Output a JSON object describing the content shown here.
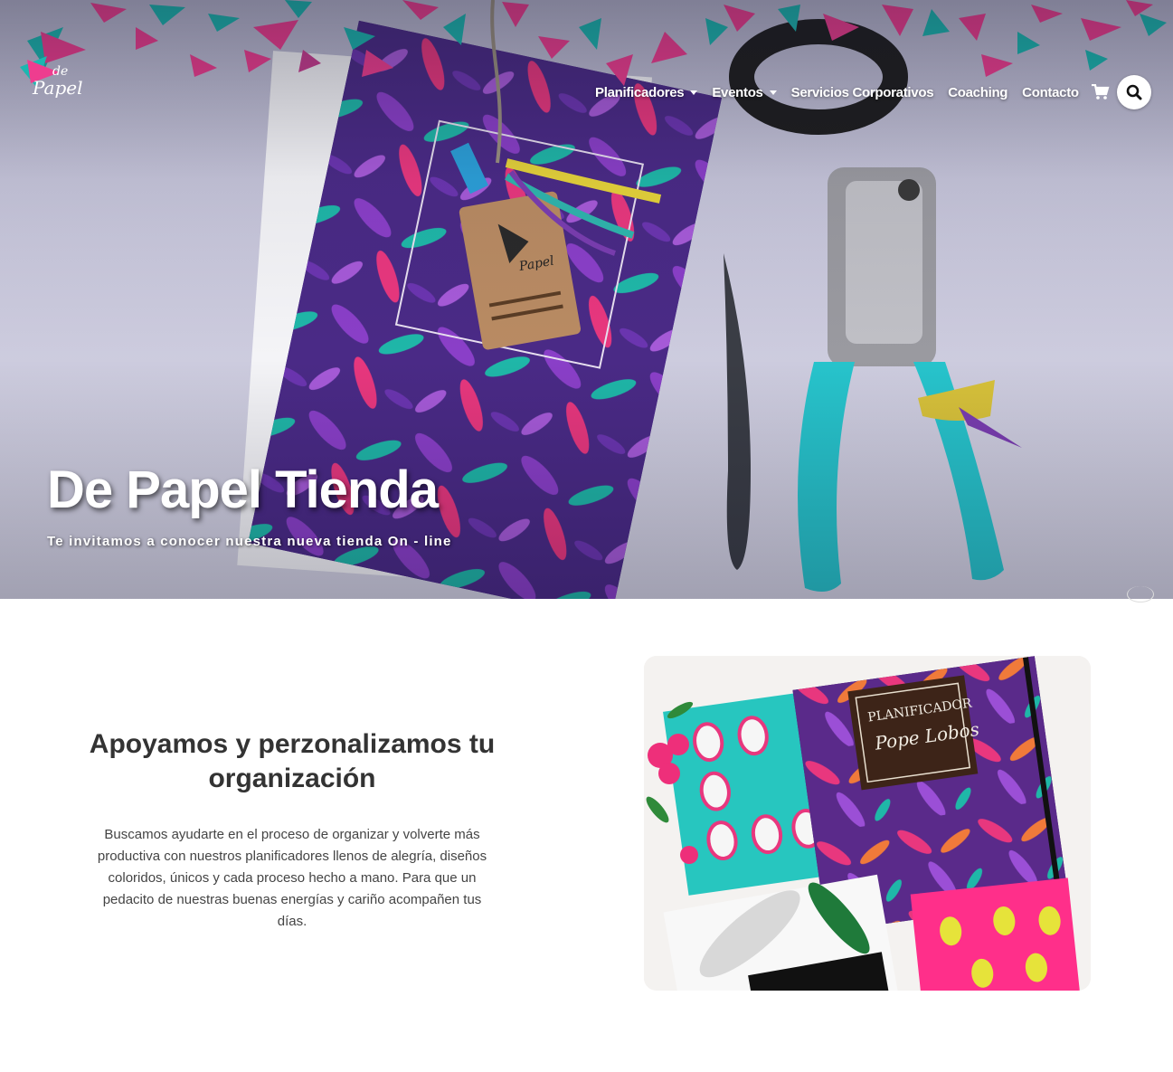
{
  "brand": {
    "logo_text_top": "de",
    "logo_text_bottom": "Papel"
  },
  "nav": {
    "items": [
      {
        "label": "Planificadores",
        "dropdown": true
      },
      {
        "label": "Eventos",
        "dropdown": true
      },
      {
        "label": "Servicios Corporativos",
        "dropdown": false
      },
      {
        "label": "Coaching",
        "dropdown": false
      },
      {
        "label": "Contacto",
        "dropdown": false
      }
    ],
    "cart_icon": "shopping-cart-icon",
    "search_icon": "search-icon"
  },
  "hero": {
    "title": "De Papel Tienda",
    "subtitle": "Te invitamos a conocer nuestra nueva tienda On - line"
  },
  "about": {
    "title": "Apoyamos y perzonalizamos tu organización",
    "text": "Buscamos ayudarte en el proceso de organizar y volverte más productiva con nuestros planificadores llenos de alegría, diseños coloridos, únicos y cada proceso hecho a mano. Para que un pedacito de nuestras buenas energías y cariño acompañen tus días.",
    "image_planner_label": "PLANIFICADOR",
    "image_planner_name": "Pope Lobos"
  },
  "colors": {
    "pink": "#ee3d8f",
    "teal": "#1bb7b0",
    "purple": "#5a2a9a",
    "text": "#333333"
  }
}
